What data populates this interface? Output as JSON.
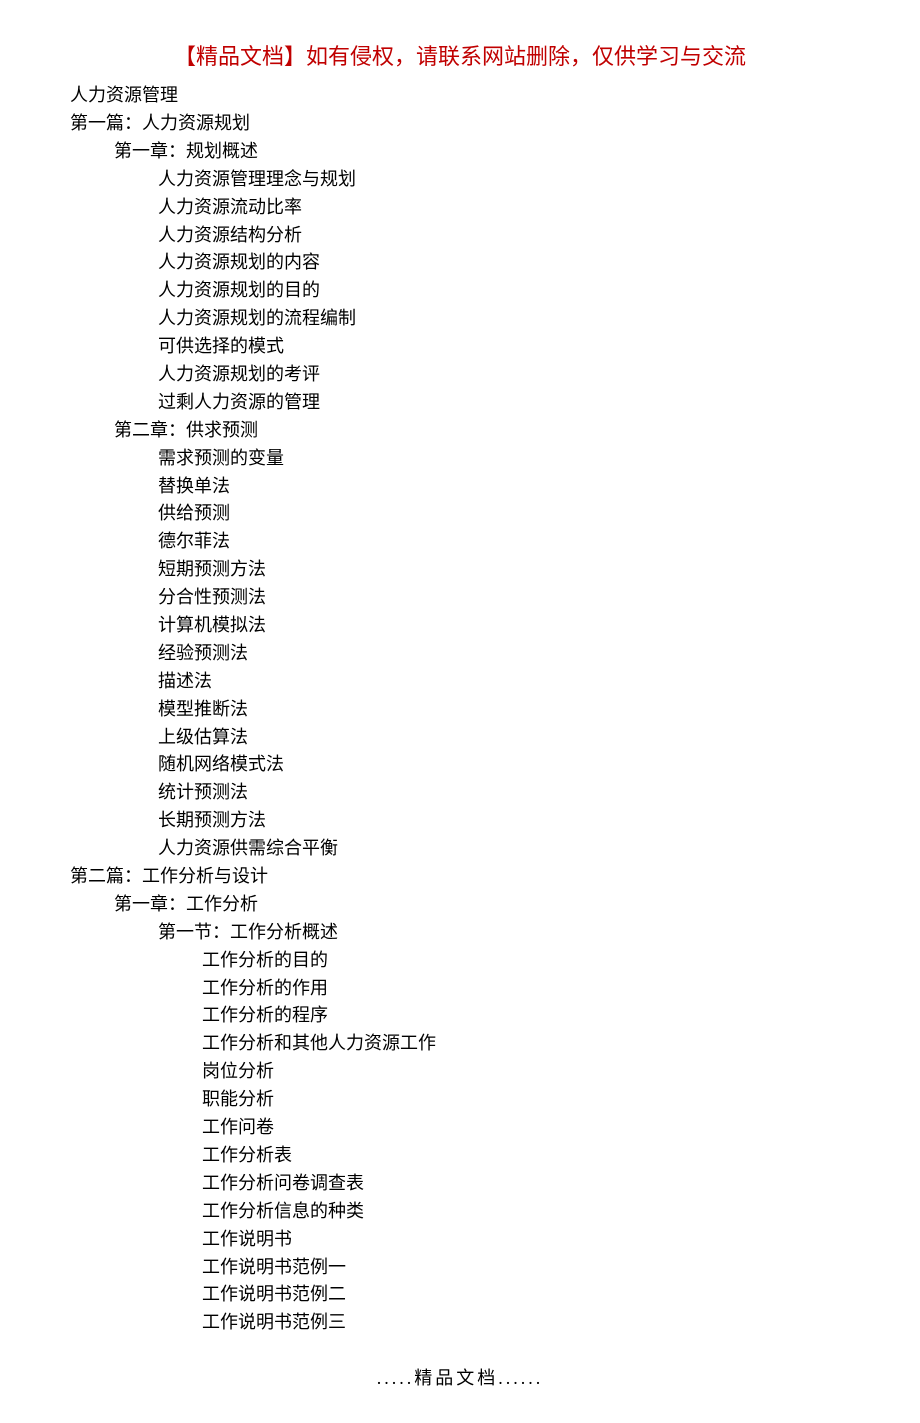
{
  "header": "【精品文档】如有侵权，请联系网站删除，仅供学习与交流",
  "footer": ".....精品文档......",
  "outline": [
    {
      "level": 1,
      "text": "人力资源管理"
    },
    {
      "level": 1,
      "text": "第一篇：人力资源规划"
    },
    {
      "level": 2,
      "text": "第一章：规划概述"
    },
    {
      "level": 3,
      "text": "人力资源管理理念与规划"
    },
    {
      "level": 3,
      "text": "人力资源流动比率"
    },
    {
      "level": 3,
      "text": "人力资源结构分析"
    },
    {
      "level": 3,
      "text": "人力资源规划的内容"
    },
    {
      "level": 3,
      "text": "人力资源规划的目的"
    },
    {
      "level": 3,
      "text": "人力资源规划的流程编制"
    },
    {
      "level": 3,
      "text": "可供选择的模式"
    },
    {
      "level": 3,
      "text": "人力资源规划的考评"
    },
    {
      "level": 3,
      "text": "过剩人力资源的管理"
    },
    {
      "level": 2,
      "text": "第二章：供求预测"
    },
    {
      "level": 3,
      "text": "需求预测的变量"
    },
    {
      "level": 3,
      "text": "替换单法"
    },
    {
      "level": 3,
      "text": "供给预测"
    },
    {
      "level": 3,
      "text": "德尔菲法"
    },
    {
      "level": 3,
      "text": "短期预测方法"
    },
    {
      "level": 3,
      "text": "分合性预测法"
    },
    {
      "level": 3,
      "text": "计算机模拟法"
    },
    {
      "level": 3,
      "text": "经验预测法"
    },
    {
      "level": 3,
      "text": "描述法"
    },
    {
      "level": 3,
      "text": "模型推断法"
    },
    {
      "level": 3,
      "text": "上级估算法"
    },
    {
      "level": 3,
      "text": "随机网络模式法"
    },
    {
      "level": 3,
      "text": "统计预测法"
    },
    {
      "level": 3,
      "text": "长期预测方法"
    },
    {
      "level": 3,
      "text": "人力资源供需综合平衡"
    },
    {
      "level": 1,
      "text": "第二篇：工作分析与设计"
    },
    {
      "level": 2,
      "text": "第一章：工作分析"
    },
    {
      "level": 3,
      "text": "第一节：工作分析概述"
    },
    {
      "level": 4,
      "text": "工作分析的目的"
    },
    {
      "level": 4,
      "text": "工作分析的作用"
    },
    {
      "level": 4,
      "text": "工作分析的程序"
    },
    {
      "level": 4,
      "text": "工作分析和其他人力资源工作"
    },
    {
      "level": 4,
      "text": "岗位分析"
    },
    {
      "level": 4,
      "text": "职能分析"
    },
    {
      "level": 4,
      "text": "工作问卷"
    },
    {
      "level": 4,
      "text": "工作分析表"
    },
    {
      "level": 4,
      "text": "工作分析问卷调查表"
    },
    {
      "level": 4,
      "text": "工作分析信息的种类"
    },
    {
      "level": 4,
      "text": "工作说明书"
    },
    {
      "level": 4,
      "text": "工作说明书范例一"
    },
    {
      "level": 4,
      "text": "工作说明书范例二"
    },
    {
      "level": 4,
      "text": "工作说明书范例三"
    }
  ]
}
